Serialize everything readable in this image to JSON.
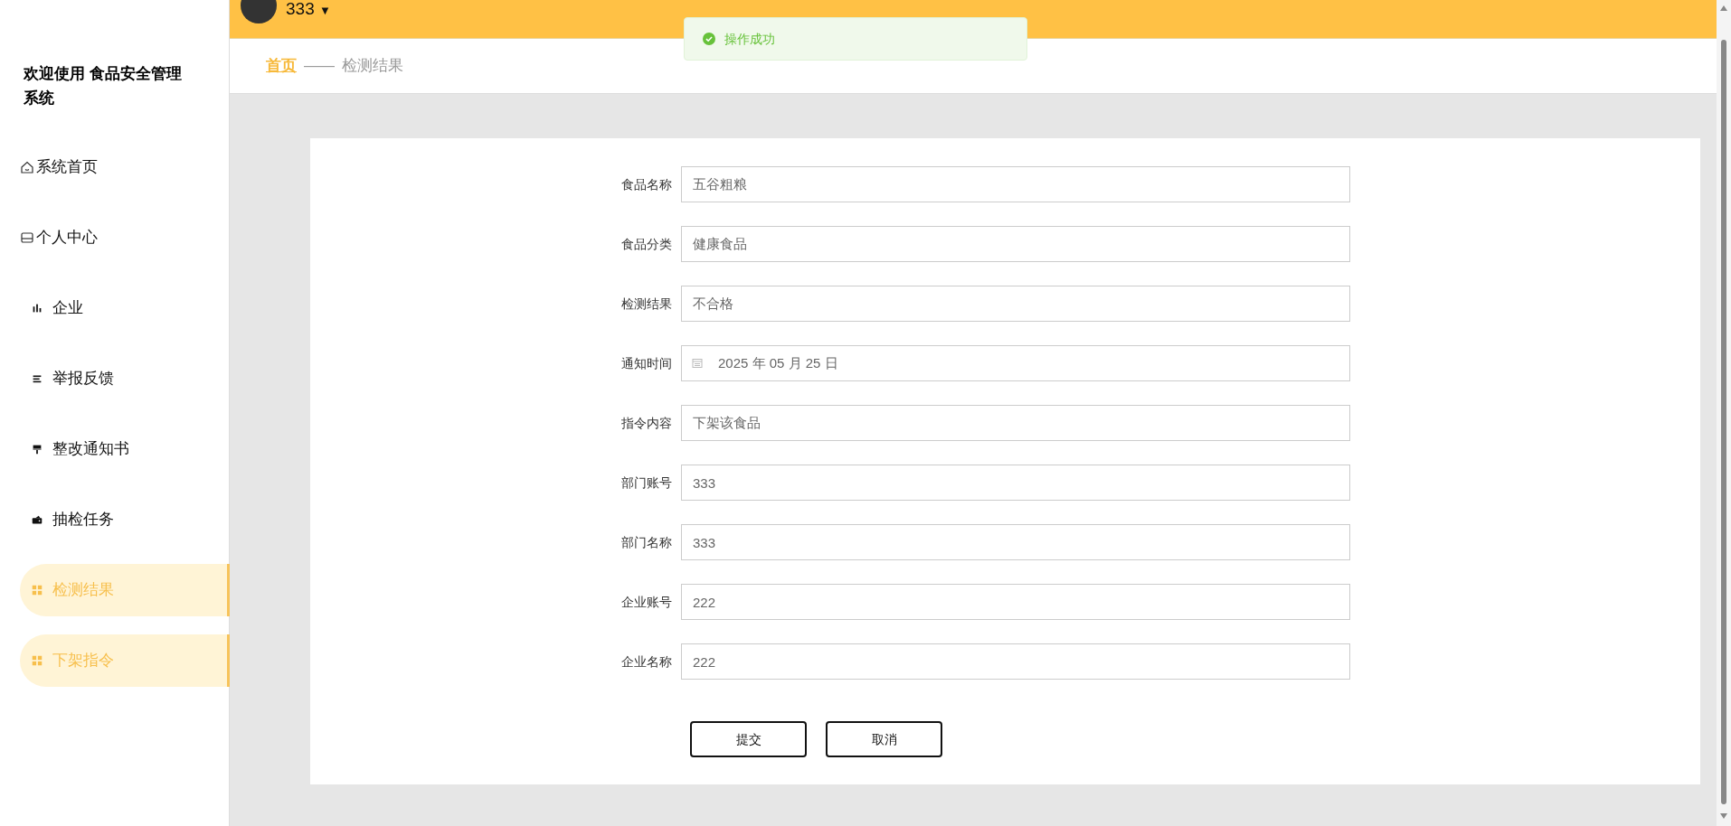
{
  "sidebar": {
    "title": "欢迎使用 食品安全管理系统",
    "items": [
      {
        "label": "系统首页",
        "kind": "home",
        "selected": false
      },
      {
        "label": "个人中心",
        "kind": "card",
        "selected": false
      },
      {
        "label": "企业",
        "kind": "bars",
        "selected": false
      },
      {
        "label": "举报反馈",
        "kind": "lines",
        "selected": false
      },
      {
        "label": "整改通知书",
        "kind": "brush",
        "selected": false
      },
      {
        "label": "抽检任务",
        "kind": "wallet",
        "selected": false
      },
      {
        "label": "检测结果",
        "kind": "grid",
        "selected": true
      },
      {
        "label": "下架指令",
        "kind": "grid",
        "selected": true
      }
    ]
  },
  "header": {
    "username": "333",
    "caret": "▼"
  },
  "toast": {
    "message": "操作成功"
  },
  "breadcrumb": {
    "home": "首页",
    "separator": "——",
    "current": "检测结果"
  },
  "form": {
    "fields": [
      {
        "label": "食品名称",
        "value": "五谷粗粮",
        "kind": "text"
      },
      {
        "label": "食品分类",
        "value": "健康食品",
        "kind": "text"
      },
      {
        "label": "检测结果",
        "value": "不合格",
        "kind": "text"
      },
      {
        "label": "通知时间",
        "value": "2025 年 05 月 25 日",
        "kind": "date"
      },
      {
        "label": "指令内容",
        "value": "下架该食品",
        "kind": "text"
      },
      {
        "label": "部门账号",
        "value": "333",
        "kind": "text"
      },
      {
        "label": "部门名称",
        "value": "333",
        "kind": "text"
      },
      {
        "label": "企业账号",
        "value": "222",
        "kind": "text"
      },
      {
        "label": "企业名称",
        "value": "222",
        "kind": "text"
      }
    ],
    "buttons": [
      "提交",
      "取消"
    ]
  }
}
